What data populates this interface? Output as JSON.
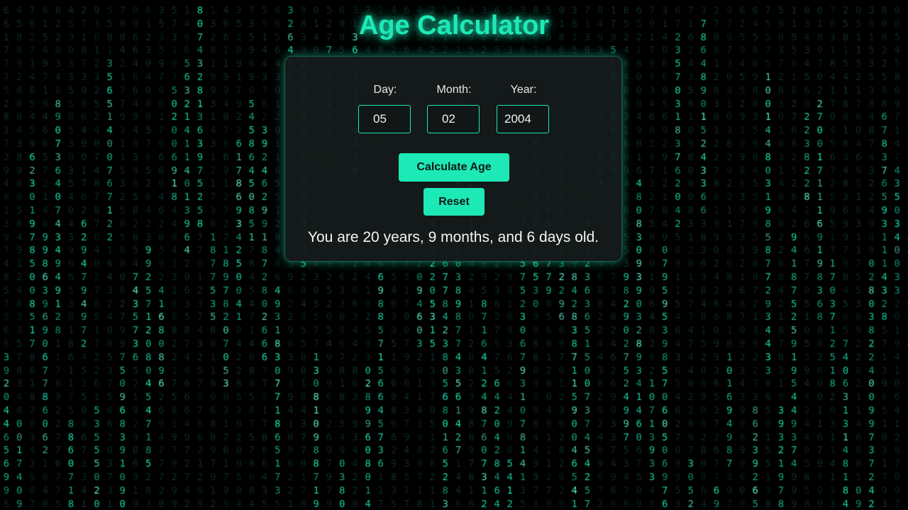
{
  "app": {
    "title": "Age Calculator"
  },
  "form": {
    "day": {
      "label": "Day:",
      "value": "05"
    },
    "month": {
      "label": "Month:",
      "value": "02"
    },
    "year": {
      "label": "Year:",
      "value": "2004"
    }
  },
  "buttons": {
    "calculate_label": "Calculate Age",
    "reset_label": "Reset"
  },
  "result": {
    "text": "You are 20 years, 9 months, and 6 days old."
  },
  "theme": {
    "accent": "#1de9b6",
    "background": "#000000",
    "card_bg": "#161b1b",
    "rain_dim": "#13352e"
  }
}
